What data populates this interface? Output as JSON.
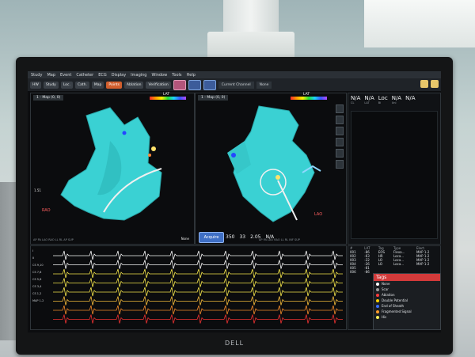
{
  "menu": [
    "Study",
    "Map",
    "Event",
    "Catheter",
    "ECG",
    "Display",
    "Imaging",
    "Window",
    "Tools",
    "Help"
  ],
  "toolbar": {
    "tabs": [
      "HW",
      "Study",
      "Loc.",
      "Cath.",
      "Map"
    ],
    "active_tab": "Points",
    "tabs_after": [
      "Ablation",
      "Verification"
    ],
    "field_label": "Current Channel",
    "field_value": "None"
  },
  "map_left": {
    "header": "1 - Map (0, 0)",
    "lat": "LAT",
    "view": "RAO",
    "scale": "1.51",
    "unit": "cm",
    "axis": "AP PA LAO RAO LL RL AP SUP",
    "option": "None"
  },
  "map_right": {
    "header": "1 - Map (0, 0)",
    "lat": "LAT",
    "view": "LAO",
    "axis": "AP PA LAO RAO LL RL INF SUP"
  },
  "acquire_label": "Acquire",
  "readout": {
    "values": [
      "350",
      "33",
      "2.05",
      "N/A"
    ],
    "labels": [
      "CL",
      "LAT",
      "Bi",
      "Uni"
    ]
  },
  "info": {
    "cols": [
      [
        "N/A",
        "CL"
      ],
      [
        "N/A",
        "LAT"
      ],
      [
        "Loc",
        "Bi"
      ],
      [
        "N/A",
        "Uni"
      ],
      [
        "N/A",
        ""
      ]
    ]
  },
  "ecg": {
    "channels": [
      "I",
      "II",
      "CS 9,10",
      "CS 7,8",
      "CS 5,6",
      "CS 3,4",
      "CS 1,2",
      "MAP 1-2"
    ],
    "gain": "1.00 (mV)"
  },
  "lesions": {
    "headers": [
      "#",
      "LAT",
      "Tag",
      "Type",
      "Elect."
    ],
    "rows": [
      [
        "001",
        "-86",
        "EOS",
        "Flexa...",
        "MAP 1-2"
      ],
      [
        "002",
        "-63",
        "HR",
        "Loca...",
        "MAP 1-2"
      ],
      [
        "003",
        "-22",
        "LO",
        "Loca...",
        "MAP 1-2"
      ],
      [
        "004",
        "-26",
        "LO",
        "Loca...",
        "MAP 1-2"
      ],
      [
        "005",
        "-81",
        "",
        "",
        ""
      ],
      [
        "006",
        "-86",
        "",
        "",
        ""
      ]
    ]
  },
  "tags": {
    "title": "Tags",
    "items": [
      {
        "label": "None",
        "color": "#ffffff"
      },
      {
        "label": "Scar",
        "color": "#9b9b9b"
      },
      {
        "label": "Ablation",
        "color": "#ff3b3b"
      },
      {
        "label": "Double Potential",
        "color": "#ffd400"
      },
      {
        "label": "End of Sheath",
        "color": "#3b6dff"
      },
      {
        "label": "Fragmented Signal",
        "color": "#ff9b2a"
      },
      {
        "label": "His",
        "color": "#ffef5a"
      }
    ]
  },
  "ecg_colors": [
    "#f5f5f5",
    "#f5f5f5",
    "#f1e24a",
    "#f1e24a",
    "#f1e24a",
    "#f1b93a",
    "#f18a2a",
    "#e83030"
  ],
  "brand": "DELL"
}
